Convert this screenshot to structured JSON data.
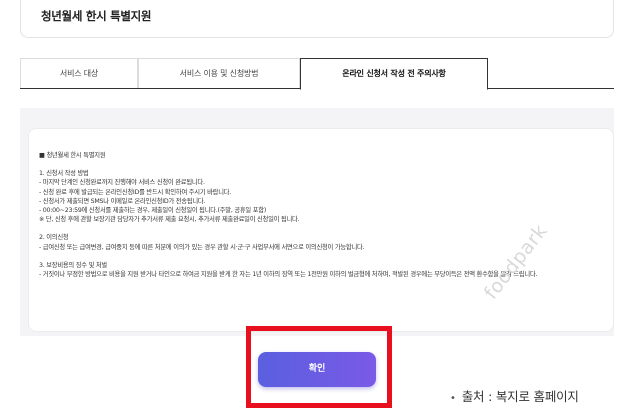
{
  "header": {
    "title": "청년월세 한시 특별지원"
  },
  "tabs": [
    {
      "label": "서비스 대상",
      "active": false
    },
    {
      "label": "서비스 이용 및 신청방법",
      "active": false
    },
    {
      "label": "온라인 신청서 작성 전 주의사항",
      "active": true
    }
  ],
  "notice": {
    "heading": "■ 청년월세 한시 특별지원",
    "section1": {
      "title": "1. 신청서 작성 방법",
      "items": [
        "- 마지막 단계인 신청완료까지 진행해야 서비스 신청이 완료됩니다.",
        "- 신청 완료 후에 발급되는 온라인신청ID를 반드시 확인하여 주시기 바랍니다.",
        "- 신청서가 제출되면 SMS나 이메일로 온라인신청ID가 전송됩니다.",
        "- 00:00~23:59에 신청서를 제출하는 경우, 제출일이 신청일이 됩니다.(주말, 공휴일 포함)",
        "※ 단, 신청 후에 관할 보장기관 담당자가 추가서류 제출 요청시, 추가서류 제출완료일이 신청일이 됩니다."
      ]
    },
    "section2": {
      "title": "2. 이의신청",
      "items": [
        "- 급여신청 또는 급여변경, 급여중지 등에 따른 처분에 이의가 있는 경우 관할 시·군·구 사업부서에 서면으로 이의신청이 가능합니다."
      ]
    },
    "section3": {
      "title": "3. 보장비용의 징수 및 처벌",
      "items": [
        "- 거짓이나 부정한 방법으로 비용을 지원 받거나 타인으로 하여금 지원을 받게 한 자는 1년 이하의 징역 또는 1천만원 이하의 벌금형에 처하며, 적발된 경우에는 부당이득은 전액 환수함을 알려 드립니다."
      ]
    }
  },
  "watermark": "foodpark",
  "confirm_button": {
    "label": "확인"
  },
  "source": {
    "bullet": "•",
    "text": "출처 : 복지로 홈페이지"
  }
}
